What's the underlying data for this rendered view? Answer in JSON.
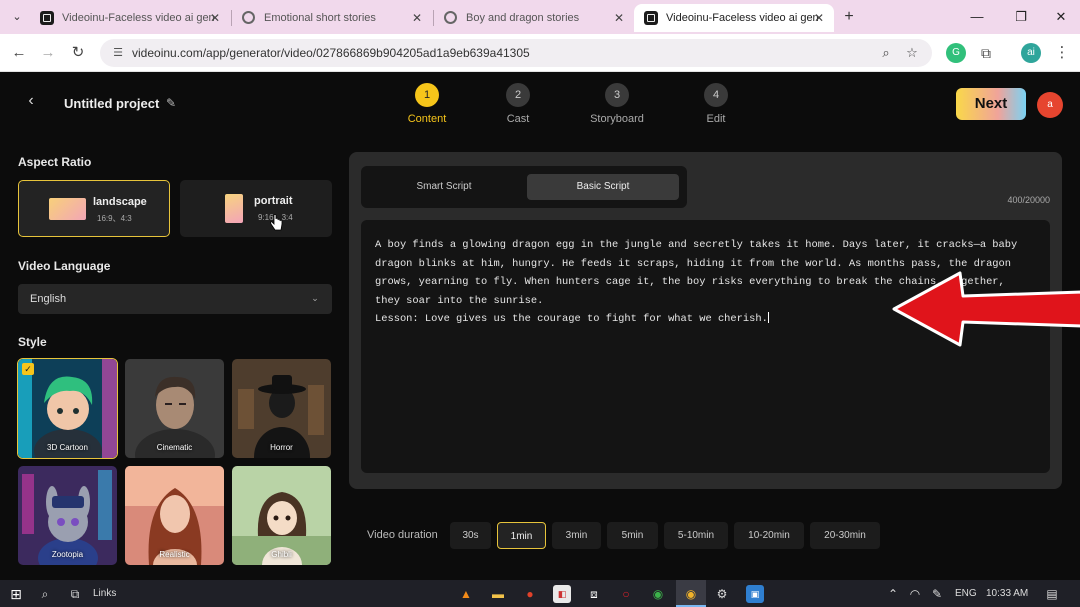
{
  "browser": {
    "tabs": [
      {
        "title": "Videoinu-Faceless video ai gen",
        "active": false,
        "favicon": "videoinu"
      },
      {
        "title": "Emotional short stories",
        "active": false,
        "favicon": "grok"
      },
      {
        "title": "Boy and dragon stories",
        "active": false,
        "favicon": "grok"
      },
      {
        "title": "Videoinu-Faceless video ai gen",
        "active": true,
        "favicon": "videoinu"
      }
    ],
    "tab_close_glyph": "✕",
    "new_tab_glyph": "+",
    "url": "videoinu.com/app/generator/video/027866869b904205ad1a9eb639a41305",
    "profile_initial": "ai"
  },
  "app": {
    "project_title": "Untitled project",
    "steps": [
      {
        "num": "1",
        "label": "Content",
        "active": true
      },
      {
        "num": "2",
        "label": "Cast",
        "active": false
      },
      {
        "num": "3",
        "label": "Storyboard",
        "active": false
      },
      {
        "num": "4",
        "label": "Edit",
        "active": false
      }
    ],
    "next_label": "Next",
    "user_initial": "a",
    "aspect_ratio": {
      "label": "Aspect Ratio",
      "options": [
        {
          "name": "landscape",
          "ratios": "16:9、4:3",
          "selected": true
        },
        {
          "name": "portrait",
          "ratios": "9:16、3:4",
          "selected": false
        }
      ]
    },
    "video_language": {
      "label": "Video Language",
      "value": "English"
    },
    "style": {
      "label": "Style",
      "options": [
        {
          "name": "3D Cartoon",
          "selected": true
        },
        {
          "name": "Cinematic",
          "selected": false
        },
        {
          "name": "Horror",
          "selected": false
        },
        {
          "name": "Zootopia",
          "selected": false
        },
        {
          "name": "Realistic",
          "selected": false
        },
        {
          "name": "Ghibli",
          "selected": false
        }
      ]
    },
    "script": {
      "modes": [
        {
          "label": "Smart Script",
          "active": false
        },
        {
          "label": "Basic Script",
          "active": true
        }
      ],
      "char_count": "400/20000",
      "text": "A boy finds a glowing dragon egg in the jungle and secretly takes it home. Days later, it cracks—a baby\ndragon blinks at him, hungry. He feeds it scraps, hiding it from the world. As months pass, the dragon\ngrows, yearning to fly. When hunters cage it, the boy risks everything to break the chains. Together,\nthey soar into the sunrise.\nLesson: Love gives us the courage to fight for what we cherish."
    },
    "duration": {
      "label": "Video duration",
      "options": [
        {
          "label": "30s",
          "selected": false
        },
        {
          "label": "1min",
          "selected": true
        },
        {
          "label": "3min",
          "selected": false
        },
        {
          "label": "5min",
          "selected": false
        },
        {
          "label": "5-10min",
          "selected": false
        },
        {
          "label": "10-20min",
          "selected": false
        },
        {
          "label": "20-30min",
          "selected": false
        }
      ]
    }
  },
  "taskbar": {
    "links_label": "Links",
    "language": "ENG",
    "time": "10:33 AM"
  },
  "colors": {
    "accent": "#f6c51a",
    "arrow": "#e0141b"
  }
}
